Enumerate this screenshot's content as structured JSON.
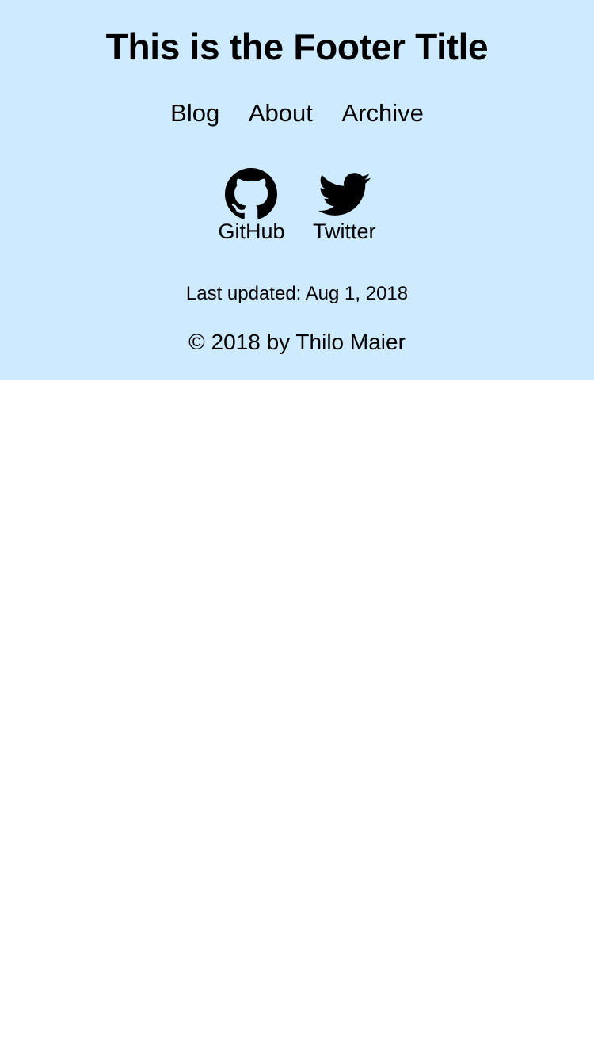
{
  "footer": {
    "title": "This is the Footer Title",
    "background_color": "#cdeafe",
    "nav": [
      {
        "label": "Blog"
      },
      {
        "label": "About"
      },
      {
        "label": "Archive"
      }
    ],
    "social": [
      {
        "label": "GitHub",
        "icon": "github-icon"
      },
      {
        "label": "Twitter",
        "icon": "twitter-icon"
      }
    ],
    "last_updated": "Last updated: Aug 1, 2018",
    "copyright": "© 2018 by Thilo Maier"
  }
}
